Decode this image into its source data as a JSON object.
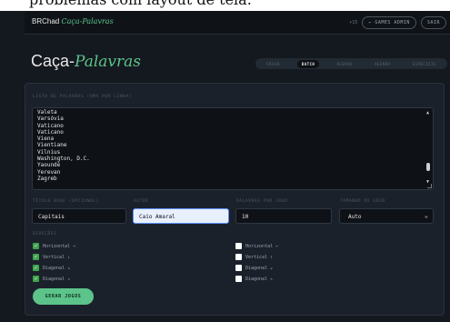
{
  "cutoff_text": "problemas com layout de tela.",
  "header": {
    "brand": "BRChad",
    "brand_accent": "Caça-Palavras",
    "counter": "+15",
    "games_admin": "← GAMES ADMIN",
    "logout": "SAIR"
  },
  "page": {
    "title": "Caça-",
    "title_accent": "Palavras"
  },
  "tabs": [
    {
      "label": "CRIAR",
      "active": false
    },
    {
      "label": "BATCH",
      "active": true
    },
    {
      "label": "ACERVO",
      "active": false
    },
    {
      "label": "AGENDA",
      "active": false
    },
    {
      "label": "ESPECIAIS",
      "active": false
    }
  ],
  "form": {
    "word_list_label": "LISTA DE PALAVRAS (UMA POR LINHA)",
    "word_list_value": "Valeta\nVarsóvia\nVaticano\nVaticano\nViena\nVientiane\nVilnius\nWashington, D.C.\nYaoundé\nYerevan\nZagreb",
    "title_label": "TÍTULO BASE (OPCIONAL)",
    "title_value": "Capitais",
    "author_label": "AUTOR",
    "author_value": "Caio Amaral",
    "words_per_game_label": "PALAVRAS POR JOGO",
    "words_per_game_value": "10",
    "grid_size_label": "TAMANHO DO GRID",
    "grid_size_value": "Auto",
    "directions_label": "DIREÇÕES",
    "directions_left": [
      {
        "label": "Horizontal →",
        "checked": true
      },
      {
        "label": "Vertical ↓",
        "checked": true
      },
      {
        "label": "Diagonal ↘",
        "checked": true
      },
      {
        "label": "Diagonal ↗",
        "checked": true
      }
    ],
    "directions_right": [
      {
        "label": "Horizontal ←",
        "checked": false
      },
      {
        "label": "Vertical ↑",
        "checked": false
      },
      {
        "label": "Diagonal ↙",
        "checked": false
      },
      {
        "label": "Diagonal ↖",
        "checked": false
      }
    ],
    "submit_label": "GERAR JOGOS"
  },
  "colors": {
    "accent": "#5cc48a",
    "background": "#14181f",
    "card": "#1b212b",
    "checkbox_on": "#3fa34d"
  }
}
